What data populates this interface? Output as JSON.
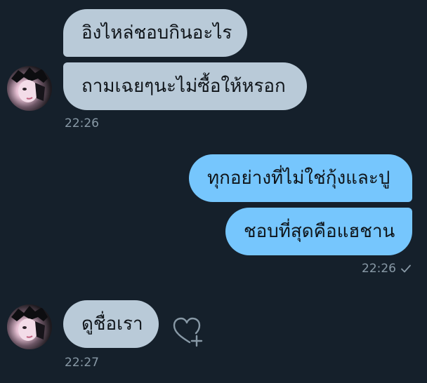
{
  "messages": {
    "in1": "อิงไหล่ชอบกินอะไร",
    "in2": "ถามเฉยๆนะไม่ซื้อให้หรอก",
    "time1": "22:26",
    "out1": "ทุกอย่างที่ไม่ใช่กุ้งและปู",
    "out2": "ชอบที่สุดคือแฮชาน",
    "time2": "22:26",
    "in3": "ดูชื่อเรา",
    "time3": "22:27"
  },
  "icons": {
    "sent": "check-icon",
    "react": "heart-plus-icon",
    "avatar": "profile-avatar"
  },
  "colors": {
    "background": "#15202b",
    "incoming_bubble": "#b9cad8",
    "outgoing_bubble": "#76c6fd",
    "timestamp": "#8899a6"
  }
}
